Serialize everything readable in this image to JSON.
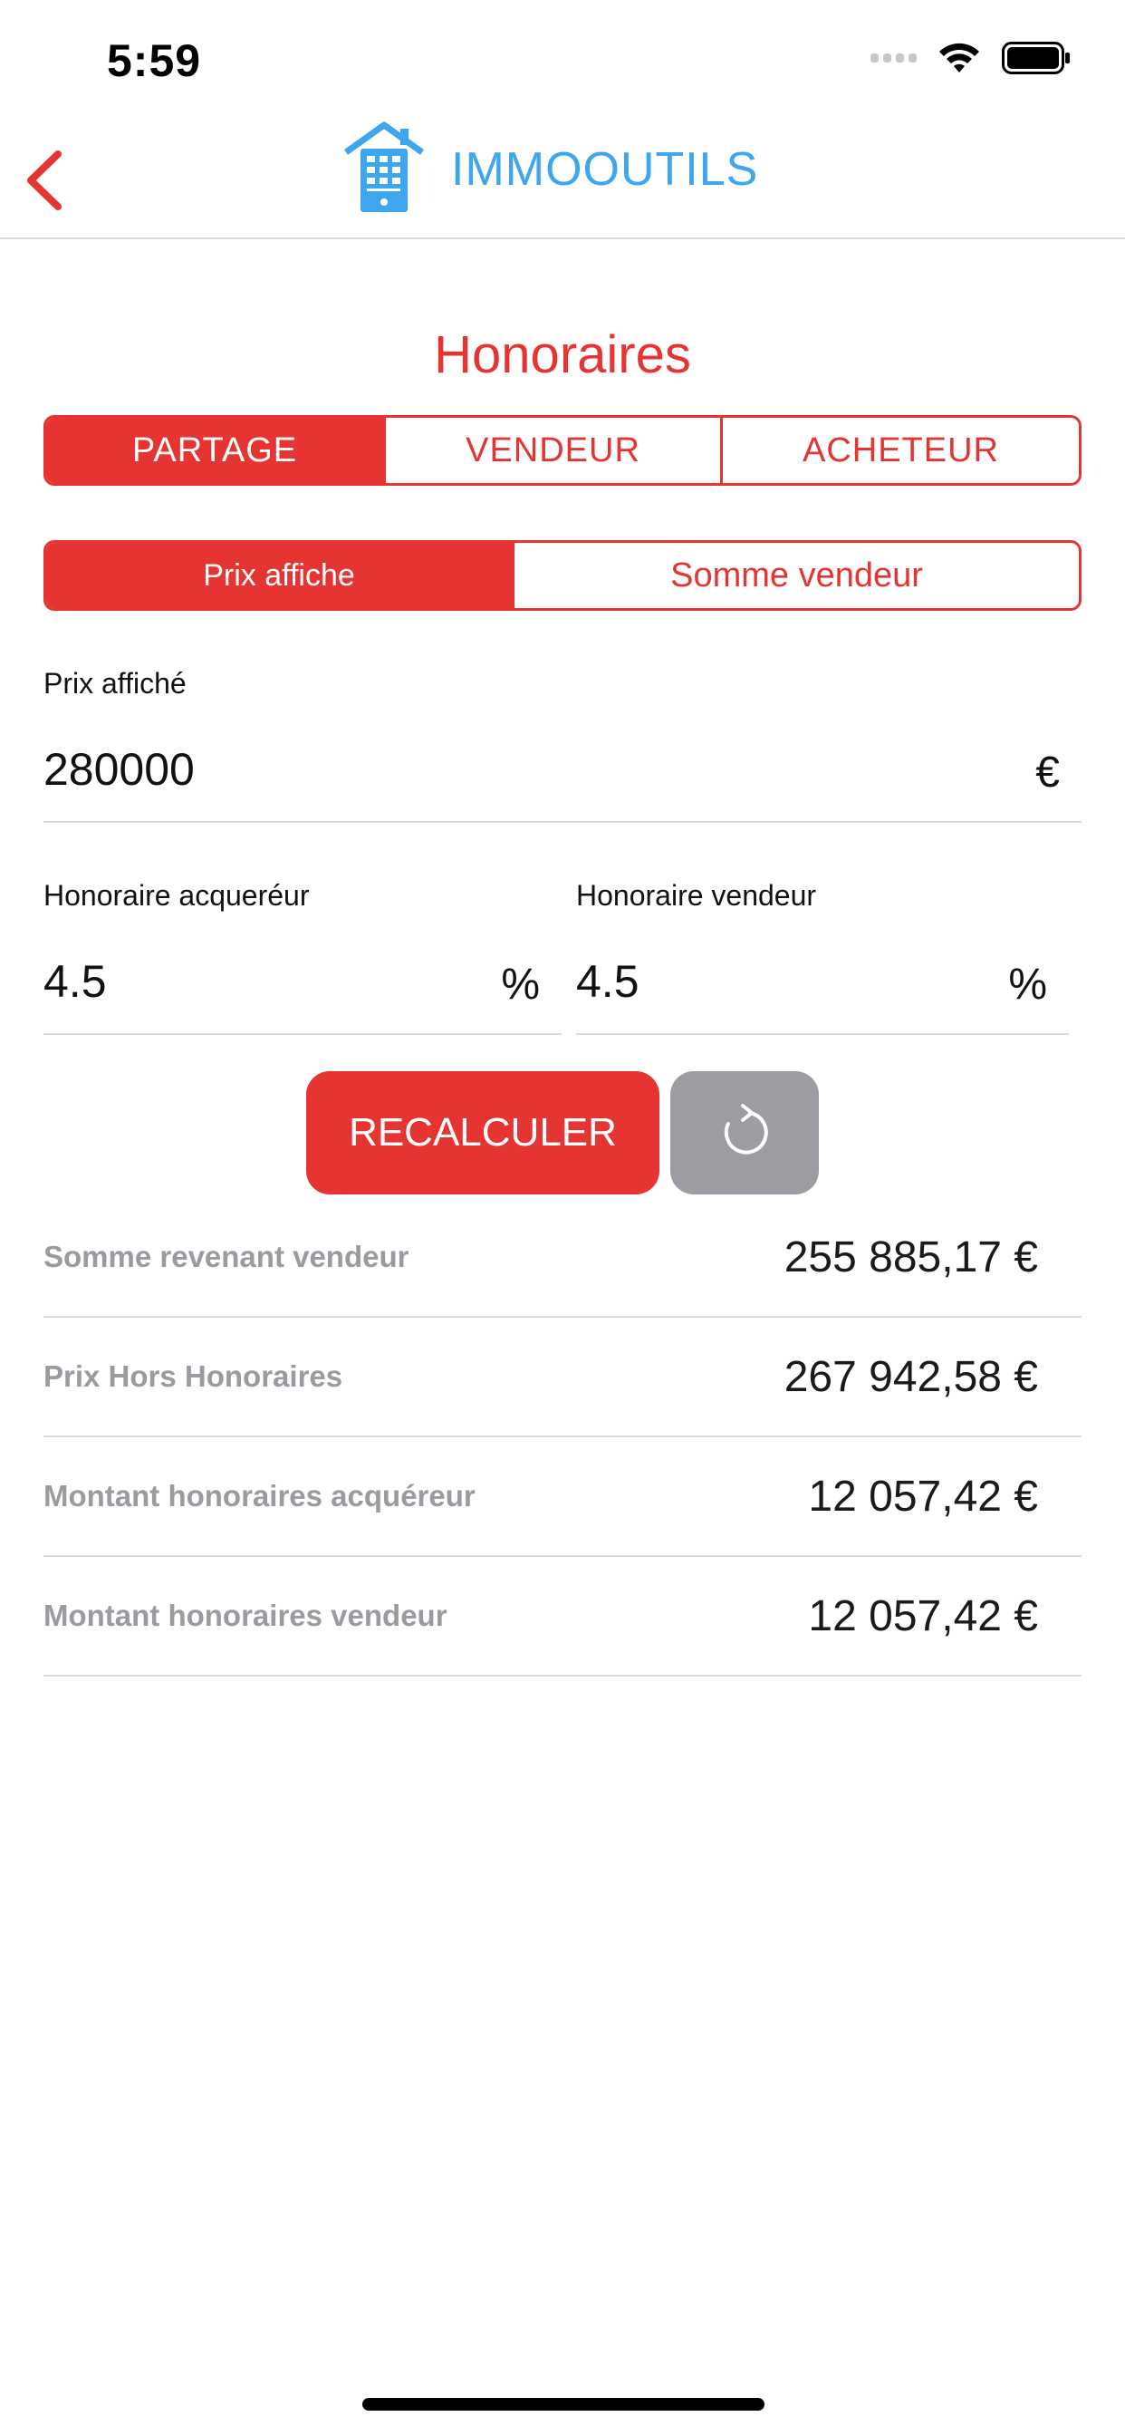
{
  "status_bar": {
    "time": "5:59"
  },
  "nav": {
    "brand": "IMMOOUTILS"
  },
  "page": {
    "title": "Honoraires"
  },
  "mode_tabs": [
    {
      "label": "PARTAGE",
      "active": true
    },
    {
      "label": "VENDEUR",
      "active": false
    },
    {
      "label": "ACHETEUR",
      "active": false
    }
  ],
  "base_tabs": [
    {
      "label": "Prix affiche",
      "active": true
    },
    {
      "label": "Somme vendeur",
      "active": false
    }
  ],
  "fields": {
    "prix": {
      "label": "Prix affiché",
      "value": "280000",
      "unit": "€"
    },
    "acquereur": {
      "label": "Honoraire acqueréur",
      "value": "4.5",
      "unit": "%"
    },
    "vendeur": {
      "label": "Honoraire vendeur",
      "value": "4.5",
      "unit": "%"
    }
  },
  "buttons": {
    "recalculate": "RECALCULER"
  },
  "results": [
    {
      "label": "Somme revenant vendeur",
      "value": "255 885,17 €"
    },
    {
      "label": "Prix Hors Honoraires",
      "value": "267 942,58 €"
    },
    {
      "label": "Montant honoraires acquéreur",
      "value": "12 057,42 €"
    },
    {
      "label": "Montant honoraires vendeur",
      "value": "12 057,42 €"
    }
  ],
  "colors": {
    "accent": "#e53431",
    "brand": "#3ea6ee",
    "muted": "#9a9aa0",
    "reset_button": "#9b9da3"
  }
}
